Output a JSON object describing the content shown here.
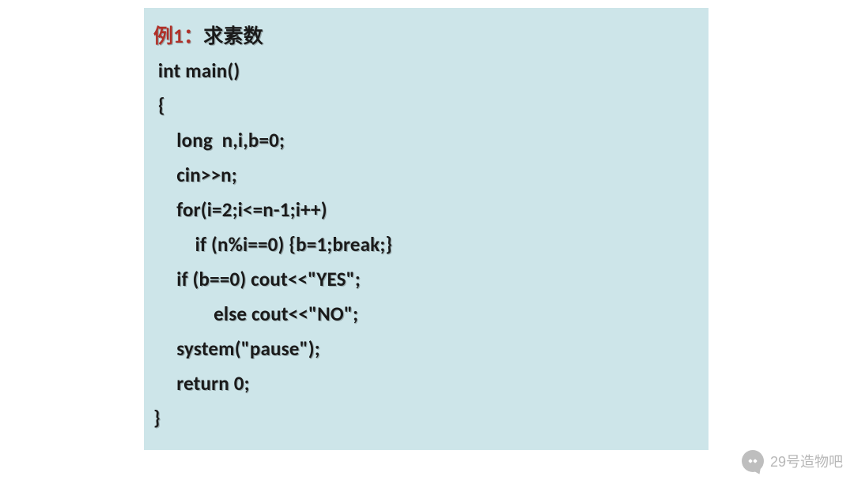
{
  "code": {
    "title_prefix": "例1：",
    "title_rest": "求素数",
    "lines": [
      " int main()",
      " {",
      "     long  n,i,b=0;",
      "     cin>>n;",
      "     for(i=2;i<=n-1;i++)",
      "         if (n%i==0) {b=1;break;}",
      "     if (b==0) cout<<\"YES\";",
      "             else cout<<\"NO\";",
      "     system(\"pause\");",
      "     return 0;",
      "}"
    ]
  },
  "watermark": {
    "text": "29号造物吧"
  }
}
